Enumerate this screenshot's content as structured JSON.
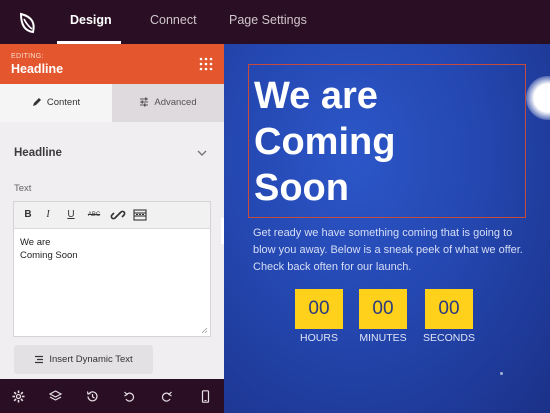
{
  "topbar": {
    "tabs": [
      {
        "label": "Design",
        "active": true
      },
      {
        "label": "Connect",
        "active": false
      },
      {
        "label": "Page Settings",
        "active": false
      }
    ]
  },
  "panel": {
    "editing_label": "EDITING:",
    "title": "Headline",
    "subtabs": {
      "content": "Content",
      "advanced": "Advanced"
    },
    "section_title": "Headline",
    "field_label": "Text",
    "editor_text": "We are\nComing Soon",
    "editor_tools": [
      "B",
      "I",
      "U",
      "ABC"
    ],
    "dynamic_button": "Insert Dynamic Text"
  },
  "canvas": {
    "headline": "We are\nComing\nSoon",
    "description": "Get ready we have something coming that is going to blow you away. Below is a sneak peek of what we offer. Check back often for our launch.",
    "countdown": [
      {
        "value": "00",
        "label": "HOURS"
      },
      {
        "value": "00",
        "label": "MINUTES"
      },
      {
        "value": "00",
        "label": "SECONDS"
      }
    ]
  },
  "colors": {
    "topbar": "#2a0f24",
    "panel_header": "#e4572e",
    "canvas_bg": "#2447b0",
    "countdown_bg": "#ffd11a",
    "headline_outline": "#c64b3b"
  },
  "bottombar_icons": [
    "gear-icon",
    "layers-icon",
    "history-icon",
    "undo-icon",
    "redo-icon",
    "mobile-icon"
  ]
}
